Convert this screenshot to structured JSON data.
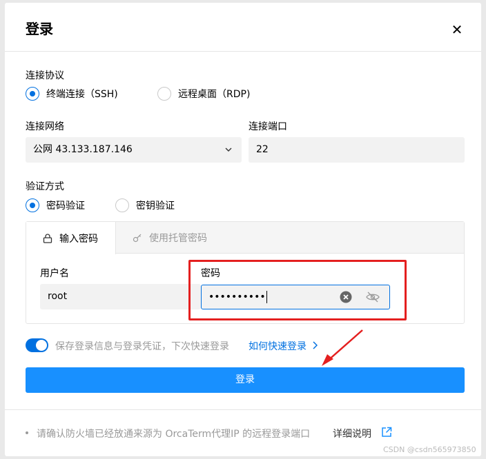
{
  "dialog": {
    "title": "登录",
    "close_icon": "close-icon"
  },
  "protocol": {
    "label": "连接协议",
    "options": [
      {
        "label": "终端连接（SSH)",
        "selected": true
      },
      {
        "label": "远程桌面（RDP)",
        "selected": false
      }
    ]
  },
  "network": {
    "label": "连接网络",
    "value": "公网 43.133.187.146"
  },
  "port": {
    "label": "连接端口",
    "value": "22"
  },
  "auth": {
    "label": "验证方式",
    "options": [
      {
        "label": "密码验证",
        "selected": true
      },
      {
        "label": "密钥验证",
        "selected": false
      }
    ],
    "tabs": [
      {
        "label": "输入密码",
        "icon": "lock-icon",
        "active": true
      },
      {
        "label": "使用托管密码",
        "icon": "key-icon",
        "active": false
      }
    ],
    "username_label": "用户名",
    "username_value": "root",
    "password_label": "密码",
    "password_value": "••••••••••"
  },
  "save": {
    "enabled": true,
    "label": "保存登录信息与登录凭证，下次快速登录",
    "link": "如何快速登录",
    "link_icon": "chevron-right-icon"
  },
  "submit_label": "登录",
  "footer": {
    "note": "请确认防火墙已经放通来源为 OrcaTerm代理IP 的远程登录端口",
    "link": "详细说明",
    "link_icon": "external-link-icon"
  },
  "watermark": "CSDN @csdn565973850",
  "colors": {
    "primary": "#1890ff",
    "accent": "#0070e0",
    "annotation": "#e41f1f"
  }
}
